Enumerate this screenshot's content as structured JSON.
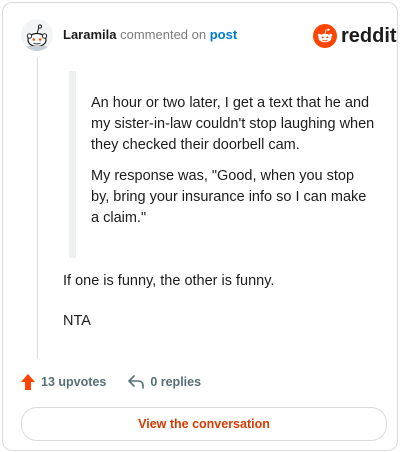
{
  "header": {
    "username": "Laramila",
    "action": "commented on",
    "link": "post"
  },
  "brand": {
    "wordmark": "reddit",
    "logo_icon": "reddit-logo-icon",
    "color": "#ff4500"
  },
  "comment": {
    "quote_paragraphs": [
      "An hour or two later, I get a text that he and my sister-in-law couldn't stop laughing when they checked their doorbell cam.",
      "My response was, \"Good, when you stop by, bring your insurance info so I can make a claim.\""
    ],
    "body_paragraphs": [
      "If one is funny, the other is funny.",
      "NTA"
    ]
  },
  "footer": {
    "upvotes_label": "13 upvotes",
    "upvote_icon": "upvote-arrow-icon",
    "upvote_color": "#ff4500",
    "replies_label": "0 replies",
    "reply_icon": "reply-arrow-icon"
  },
  "cta": {
    "label": "View the conversation",
    "color": "#d93a00"
  }
}
